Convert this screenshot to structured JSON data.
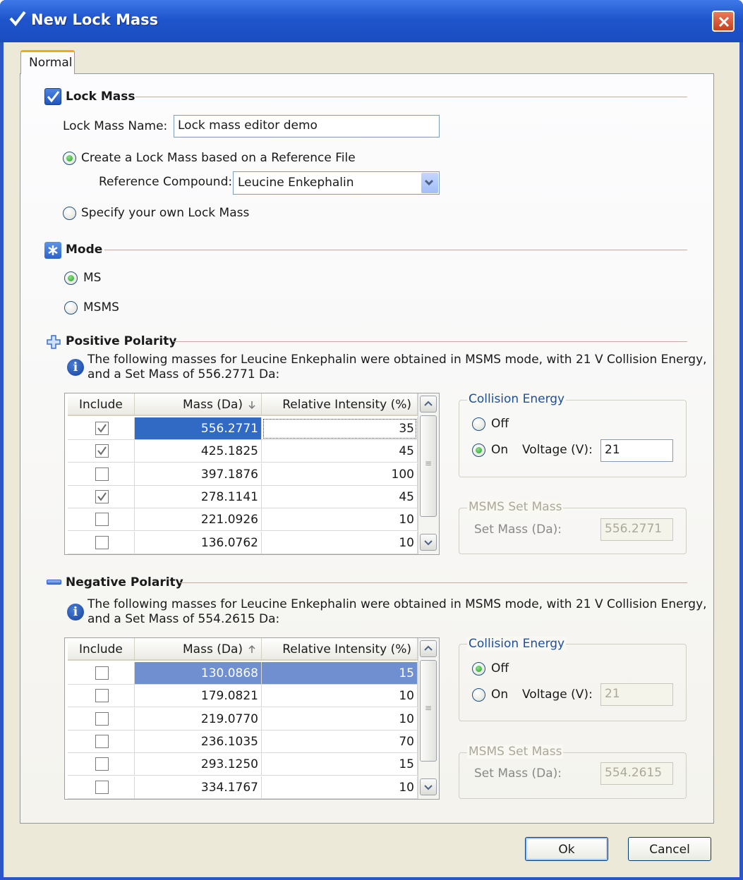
{
  "window": {
    "title": "New Lock Mass"
  },
  "tabs": [
    {
      "label": "Normal"
    }
  ],
  "lock_mass": {
    "section_title": "Lock Mass",
    "name_label": "Lock Mass Name:",
    "name_value": "Lock mass editor demo",
    "option_reference": "Create a Lock Mass based on a Reference File",
    "reference_compound_label": "Reference Compound:",
    "reference_compound_value": "Leucine Enkephalin",
    "option_own": "Specify your own Lock Mass",
    "selected_option": "reference"
  },
  "mode": {
    "section_title": "Mode",
    "ms_label": "MS",
    "msms_label": "MSMS",
    "selected": "MS"
  },
  "positive": {
    "section_title": "Positive Polarity",
    "info_line1": "The following masses for Leucine Enkephalin were obtained in MSMS mode, with 21 V Collision Energy,",
    "info_line2": "and a Set Mass of 556.2771 Da:",
    "col_include": "Include",
    "col_mass": "Mass (Da)",
    "col_intensity": "Relative Intensity (%)",
    "rows": [
      {
        "include": true,
        "mass": "556.2771",
        "intensity": "35",
        "selected": true
      },
      {
        "include": true,
        "mass": "425.1825",
        "intensity": "45"
      },
      {
        "include": false,
        "mass": "397.1876",
        "intensity": "100"
      },
      {
        "include": true,
        "mass": "278.1141",
        "intensity": "45"
      },
      {
        "include": false,
        "mass": "221.0926",
        "intensity": "10"
      },
      {
        "include": false,
        "mass": "136.0762",
        "intensity": "10"
      }
    ],
    "collision": {
      "title": "Collision Energy",
      "off_label": "Off",
      "on_label": "On",
      "voltage_label": "Voltage (V):",
      "voltage_value": "21",
      "selected": "On"
    },
    "set_mass": {
      "title": "MSMS Set Mass",
      "label": "Set Mass (Da):",
      "value": "556.2771"
    }
  },
  "negative": {
    "section_title": "Negative Polarity",
    "info_line1": "The following masses for Leucine Enkephalin were obtained in MSMS mode, with 21 V Collision Energy,",
    "info_line2": "and a Set Mass of 554.2615 Da:",
    "col_include": "Include",
    "col_mass": "Mass (Da)",
    "col_intensity": "Relative Intensity (%)",
    "rows": [
      {
        "include": false,
        "mass": "130.0868",
        "intensity": "15",
        "selected": true
      },
      {
        "include": false,
        "mass": "179.0821",
        "intensity": "10"
      },
      {
        "include": false,
        "mass": "219.0770",
        "intensity": "10"
      },
      {
        "include": false,
        "mass": "236.1035",
        "intensity": "70"
      },
      {
        "include": false,
        "mass": "293.1250",
        "intensity": "15"
      },
      {
        "include": false,
        "mass": "334.1767",
        "intensity": "10"
      }
    ],
    "collision": {
      "title": "Collision Energy",
      "off_label": "Off",
      "on_label": "On",
      "voltage_label": "Voltage (V):",
      "voltage_value": "21",
      "selected": "Off"
    },
    "set_mass": {
      "title": "MSMS Set Mass",
      "label": "Set Mass (Da):",
      "value": "554.2615"
    }
  },
  "buttons": {
    "ok": "Ok",
    "cancel": "Cancel"
  },
  "colors": {
    "title_bar": "#1f55cc",
    "selection": "#316ac5",
    "section_rule": "#c9a99e",
    "group_title": "#1c4fa0"
  }
}
